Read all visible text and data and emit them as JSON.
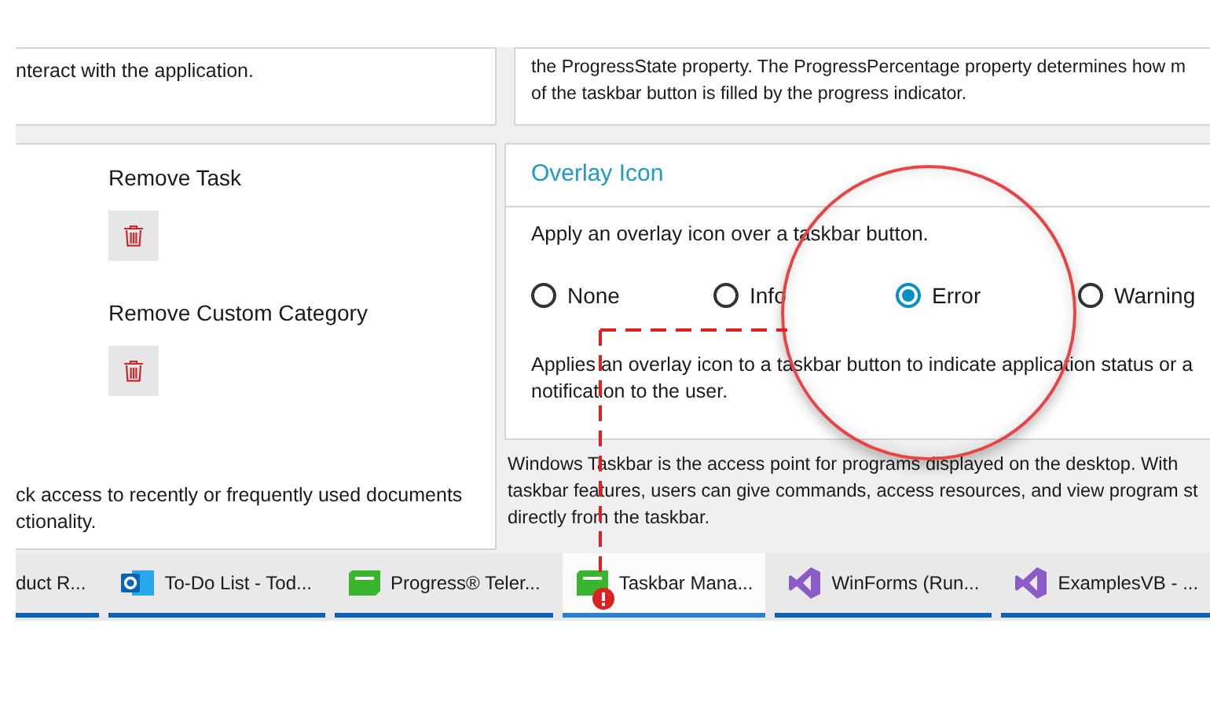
{
  "top_cards": [
    {
      "text": "nteract with the application."
    },
    {
      "text": "the ProgressState property. The ProgressPercentage property determines how m\nof the taskbar button is filled by the progress indicator."
    }
  ],
  "tasks_card": {
    "actions": [
      {
        "label": "Remove Task"
      },
      {
        "label": "Remove Custom Category"
      }
    ],
    "footer": "ck access to recently or frequently used documents\nctionality."
  },
  "overlay_card": {
    "title": "Overlay Icon",
    "prompt": "Apply an overlay icon over a taskbar button.",
    "options": [
      {
        "label": "None",
        "selected": false
      },
      {
        "label": "Info",
        "selected": false
      },
      {
        "label": "Error",
        "selected": true
      },
      {
        "label": "Warning",
        "selected": false
      }
    ],
    "description": "Applies an overlay icon to a taskbar button to indicate application status or a\nnotification to the user."
  },
  "intro": "Windows Taskbar is the access point for programs displayed on the desktop. With\ntaskbar features, users can give commands, access resources, and view program st\ndirectly from the taskbar.",
  "taskbar": [
    {
      "label": "duct R...",
      "kind": "plain",
      "selected": false,
      "alert": false
    },
    {
      "label": "To-Do List - Tod...",
      "kind": "mail",
      "selected": false,
      "alert": false
    },
    {
      "label": "Progress® Teler...",
      "kind": "app",
      "selected": false,
      "alert": false
    },
    {
      "label": "Taskbar Mana...",
      "kind": "app",
      "selected": true,
      "alert": true
    },
    {
      "label": "WinForms (Run...",
      "kind": "studio",
      "selected": false,
      "alert": false
    },
    {
      "label": "ExamplesVB - ...",
      "kind": "studio",
      "selected": false,
      "alert": false
    }
  ]
}
